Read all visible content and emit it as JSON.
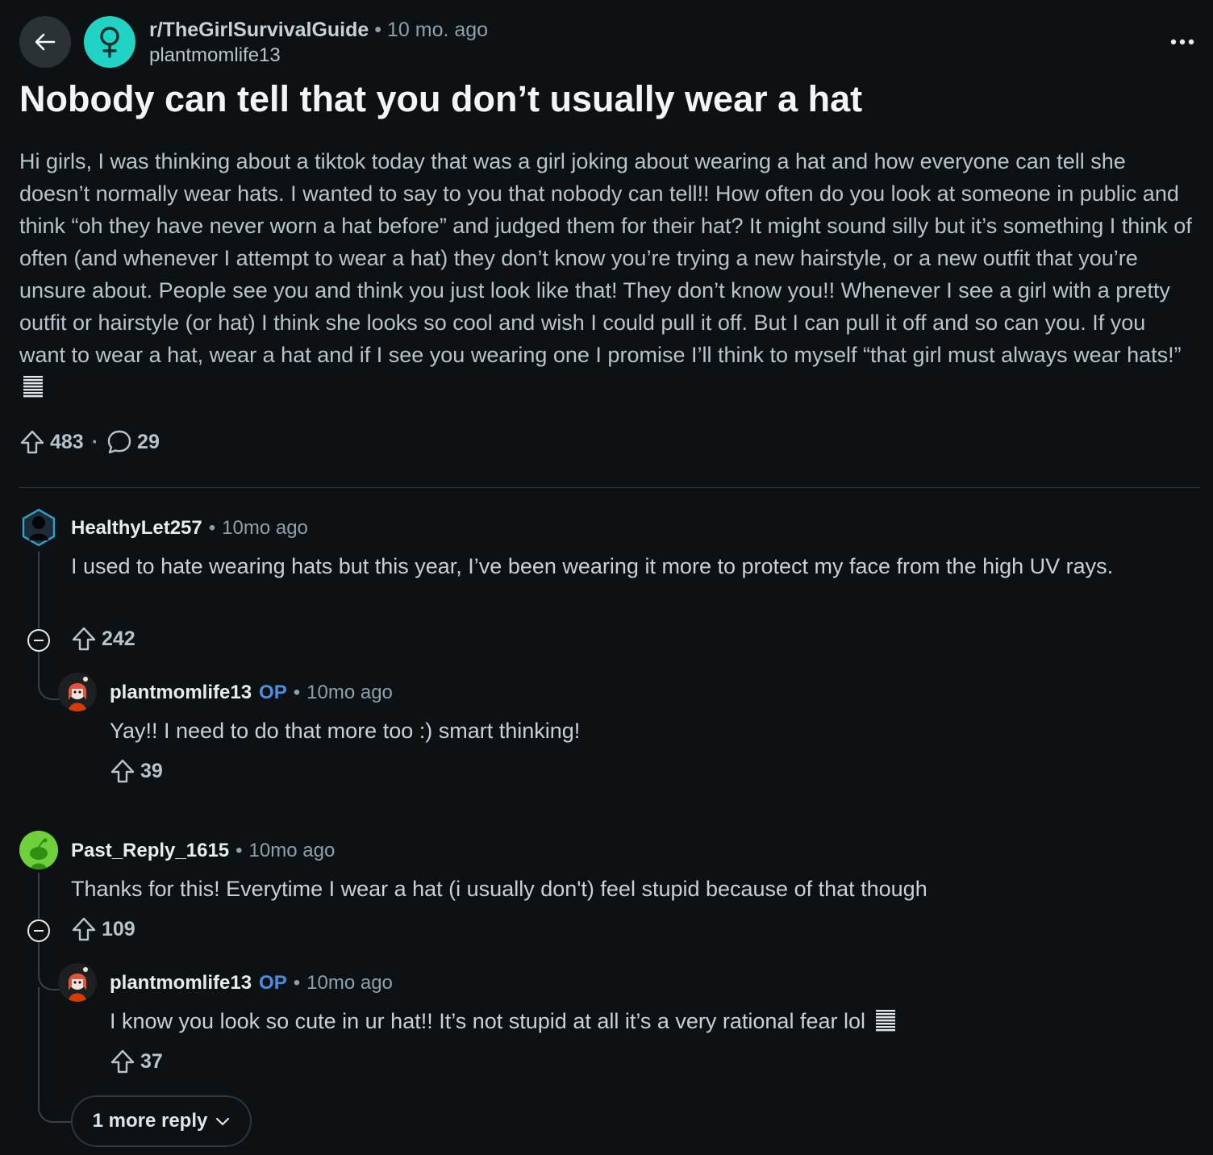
{
  "header": {
    "subreddit": "r/TheGirlSurvivalGuide",
    "separator": "•",
    "time": "10 mo. ago",
    "author": "plantmomlife13"
  },
  "post": {
    "title": "Nobody can tell that you don’t usually wear a hat",
    "body": "Hi girls, I was thinking about a tiktok today that was a girl joking about wearing a hat and how everyone can tell she doesn’t normally wear hats. I wanted to say to you that nobody can tell!! How often do you look at someone in public and think “oh they have never worn a hat before” and judged them for their hat? It might sound silly but it’s something I think of often (and whenever I attempt to wear a hat) they don’t know you’re trying a new hairstyle, or a new outfit that you’re unsure about. People see you and think you just look like that! They don’t know you!! Whenever I see a girl with a pretty outfit or hairstyle (or hat) I think she looks so cool and wish I could pull it off. But I can pull it off and so can you. If you want to wear a hat, wear a hat and if I see you wearing one I promise I’ll think to myself “that girl must always wear hats!”",
    "upvotes": "483",
    "separator": "·",
    "comments": "29"
  },
  "comments": [
    {
      "user": "HealthyLet257",
      "dot": "•",
      "time": "10mo ago",
      "body": "I used to hate wearing hats but this year, I’ve been wearing it more to protect my face from the high UV rays.",
      "upvotes": "242",
      "reply": {
        "user": "plantmomlife13",
        "badge": "OP",
        "dot": "•",
        "time": "10mo ago",
        "body": "Yay!! I need to do that more too :) smart thinking!",
        "upvotes": "39"
      }
    },
    {
      "user": "Past_Reply_1615",
      "dot": "•",
      "time": "10mo ago",
      "body": "Thanks for this! Everytime I wear a hat (i usually don't) feel stupid because of that though",
      "upvotes": "109",
      "reply": {
        "user": "plantmomlife13",
        "badge": "OP",
        "dot": "•",
        "time": "10mo ago",
        "body": "I know you look so cute in ur hat!! It’s not stupid at all it’s a very rational fear lol",
        "upvotes": "37"
      },
      "more_replies": "1 more reply"
    }
  ],
  "colors": {
    "background": "#0e1113",
    "subreddit_avatar": "#22d3c5",
    "op_badge": "#4a8fe0",
    "past_reply_avatar": "#6ed13c"
  },
  "icons": [
    "back-arrow-icon",
    "female-symbol-icon",
    "more-dots-icon",
    "upvote-icon",
    "comment-icon",
    "collapse-icon",
    "chevron-down-icon",
    "bars-emoji-icon"
  ]
}
